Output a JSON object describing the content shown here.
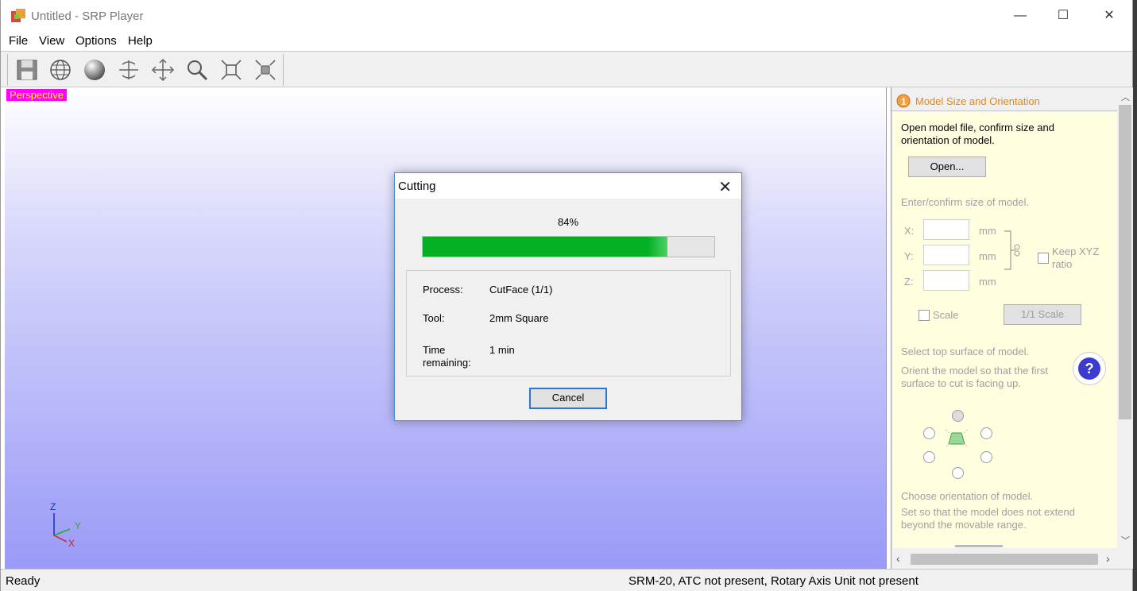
{
  "window": {
    "title": "Untitled - SRP Player",
    "min_glyph": "—",
    "max_glyph": "☐",
    "close_glyph": "✕"
  },
  "menu": [
    "File",
    "View",
    "Options",
    "Help"
  ],
  "toolbar": {
    "icons": [
      "save-icon",
      "wireframe-globe-icon",
      "shaded-sphere-icon",
      "rotate-icon",
      "pan-icon",
      "zoom-icon",
      "fit-all-icon",
      "view-icon"
    ]
  },
  "viewport": {
    "label": "Perspective",
    "axes": {
      "z": "Z",
      "y": "Y",
      "x": "X"
    }
  },
  "dialog": {
    "title": "Cutting",
    "close_glyph": "✕",
    "percent_text": "84%",
    "progress": 0.84,
    "process_label": "Process:",
    "process_value": "CutFace (1/1)",
    "tool_label": "Tool:",
    "tool_value": "2mm Square",
    "time_label_1": "Time",
    "time_label_2": "remaining:",
    "time_value": "1 min",
    "cancel_label": "Cancel",
    "progress_color": "#06b025"
  },
  "panel": {
    "step": "1",
    "title": "Model Size and Orientation",
    "intro_1": "Open model file, confirm size and",
    "intro_2": "orientation of model.",
    "open_button": "Open...",
    "size_heading": "Enter/confirm size of model.",
    "x_label": "X:",
    "y_label": "Y:",
    "z_label": "Z:",
    "unit": "mm",
    "keep_ratio_1": "Keep XYZ",
    "keep_ratio_2": "ratio",
    "scale_label": "Scale",
    "one_to_one_button": "1/1 Scale",
    "top_heading": "Select top surface of model.",
    "orient_1": "Orient the model so that the first",
    "orient_2": "surface to cut is facing up.",
    "help_glyph": "?",
    "choose_heading": "Choose orientation of model.",
    "range_1": "Set so that the model does not extend",
    "range_2": "beyond the movable range.",
    "accent_color": "#e8860c"
  },
  "status": {
    "left": "Ready",
    "right": "SRM-20, ATC not present, Rotary Axis Unit not present"
  }
}
